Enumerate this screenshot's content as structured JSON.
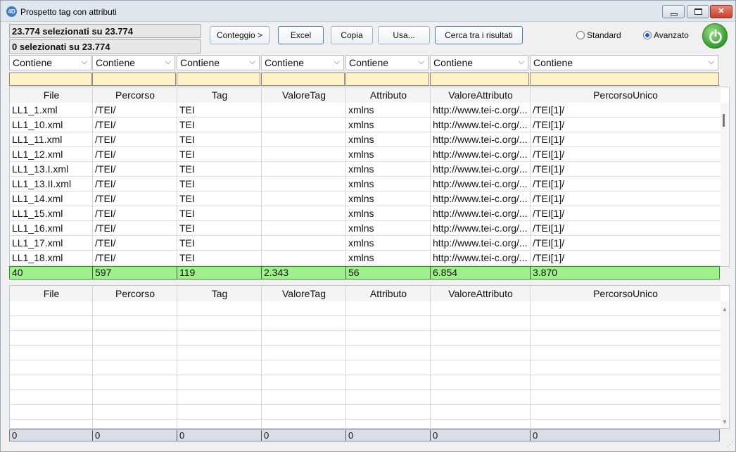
{
  "window": {
    "title": "Prospetto tag con attributi",
    "app_icon": "4D"
  },
  "counts": {
    "selected": "23.774 selezionati su 23.774",
    "selected2": "0 selezionati su 23.774"
  },
  "toolbar": {
    "conteggio": "Conteggio >",
    "excel": "Excel",
    "copia": "Copia",
    "usa": "Usa...",
    "cerca": "Cerca tra i risultati"
  },
  "mode": {
    "standard": "Standard",
    "avanzato": "Avanzato",
    "selected": "avanzato"
  },
  "filters": {
    "operator": "Contiene"
  },
  "columns": [
    "File",
    "Percorso",
    "Tag",
    "ValoreTag",
    "Attributo",
    "ValoreAttributo",
    "PercorsoUnico"
  ],
  "rows": [
    [
      "LL1_1.xml",
      "/TEI/",
      "TEI",
      "",
      "xmlns",
      "http://www.tei-c.org/...",
      "/TEI[1]/"
    ],
    [
      "LL1_10.xml",
      "/TEI/",
      "TEI",
      "",
      "xmlns",
      "http://www.tei-c.org/...",
      "/TEI[1]/"
    ],
    [
      "LL1_11.xml",
      "/TEI/",
      "TEI",
      "",
      "xmlns",
      "http://www.tei-c.org/...",
      "/TEI[1]/"
    ],
    [
      "LL1_12.xml",
      "/TEI/",
      "TEI",
      "",
      "xmlns",
      "http://www.tei-c.org/...",
      "/TEI[1]/"
    ],
    [
      "LL1_13.I.xml",
      "/TEI/",
      "TEI",
      "",
      "xmlns",
      "http://www.tei-c.org/...",
      "/TEI[1]/"
    ],
    [
      "LL1_13.II.xml",
      "/TEI/",
      "TEI",
      "",
      "xmlns",
      "http://www.tei-c.org/...",
      "/TEI[1]/"
    ],
    [
      "LL1_14.xml",
      "/TEI/",
      "TEI",
      "",
      "xmlns",
      "http://www.tei-c.org/...",
      "/TEI[1]/"
    ],
    [
      "LL1_15.xml",
      "/TEI/",
      "TEI",
      "",
      "xmlns",
      "http://www.tei-c.org/...",
      "/TEI[1]/"
    ],
    [
      "LL1_16.xml",
      "/TEI/",
      "TEI",
      "",
      "xmlns",
      "http://www.tei-c.org/...",
      "/TEI[1]/"
    ],
    [
      "LL1_17.xml",
      "/TEI/",
      "TEI",
      "",
      "xmlns",
      "http://www.tei-c.org/...",
      "/TEI[1]/"
    ],
    [
      "LL1_18.xml",
      "/TEI/",
      "TEI",
      "",
      "xmlns",
      "http://www.tei-c.org/...",
      "/TEI[1]/"
    ]
  ],
  "totals": [
    "40",
    "597",
    "119",
    "2.343",
    "56",
    "6.854",
    "3.870"
  ],
  "totals2": [
    "0",
    "0",
    "0",
    "0",
    "0",
    "0",
    "0"
  ],
  "colors": {
    "filter_bg": "#fdf2c4",
    "totals_bg": "#9ef08a",
    "power_green": "#3fa535",
    "accent_blue": "#1f5fbf"
  }
}
